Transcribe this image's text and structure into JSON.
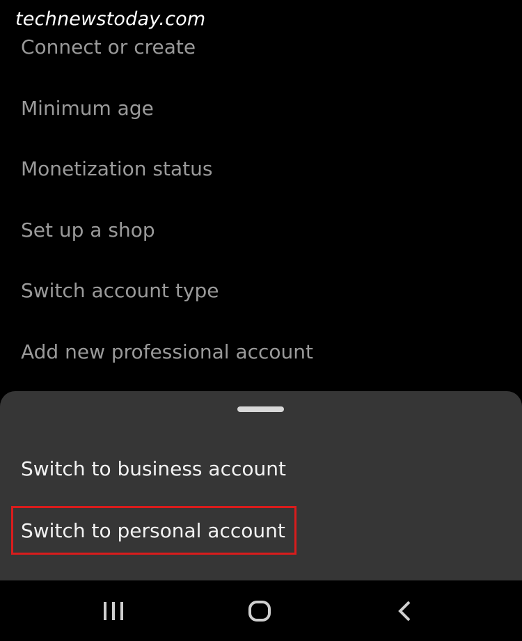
{
  "watermark": "technewstoday.com",
  "settings": {
    "items": [
      {
        "label": "Connect or create"
      },
      {
        "label": "Minimum age"
      },
      {
        "label": "Monetization status"
      },
      {
        "label": "Set up a shop"
      },
      {
        "label": "Switch account type"
      },
      {
        "label": "Add new professional account"
      }
    ]
  },
  "sheet": {
    "options": [
      {
        "label": "Switch to business account"
      },
      {
        "label": "Switch to personal account",
        "highlighted": true
      }
    ]
  },
  "navbar": {
    "buttons": [
      {
        "icon": "recent-apps-icon"
      },
      {
        "icon": "home-icon"
      },
      {
        "icon": "back-icon"
      }
    ]
  },
  "colors": {
    "background": "#000000",
    "sheet": "#363636",
    "highlight": "#d91c1c",
    "muted_text": "#9a9a9a",
    "primary_text": "#f2f2f2"
  }
}
